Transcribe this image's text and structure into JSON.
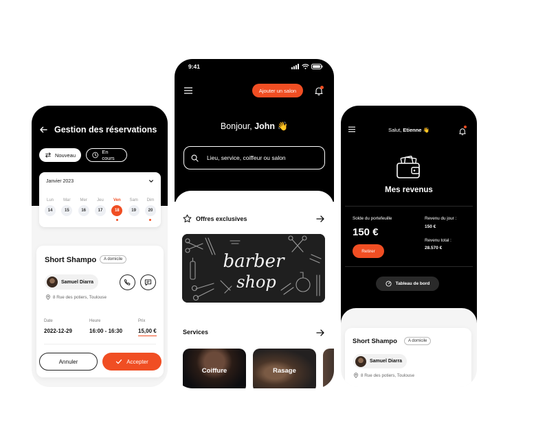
{
  "colors": {
    "accent": "#f04e23",
    "dark": "#000000",
    "surface": "#ffffff"
  },
  "left": {
    "title": "Gestion des réservations",
    "chips": [
      {
        "label": "Nouveau",
        "icon": "arrows-icon"
      },
      {
        "label": "En cours",
        "icon": "clock-icon"
      }
    ],
    "calendar": {
      "month": "Janvier 2023",
      "days": [
        {
          "name": "Lun",
          "num": "14",
          "selected": false,
          "dot": false
        },
        {
          "name": "Mar",
          "num": "15",
          "selected": false,
          "dot": false
        },
        {
          "name": "Mer",
          "num": "16",
          "selected": false,
          "dot": false
        },
        {
          "name": "Jeu",
          "num": "17",
          "selected": false,
          "dot": false
        },
        {
          "name": "Ven",
          "num": "18",
          "selected": true,
          "dot": true
        },
        {
          "name": "Sam",
          "num": "19",
          "selected": false,
          "dot": false
        },
        {
          "name": "Dim",
          "num": "20",
          "selected": false,
          "dot": true
        }
      ]
    },
    "booking": {
      "service": "Short Shampo",
      "badge": "A domicile",
      "client": "Samuel Diarra",
      "address": "8 Rue des potiers, Toulouse",
      "date_label": "Date",
      "date_value": "2022-12-29",
      "time_label": "Heure",
      "time_value": "16:00 - 16:30",
      "price_label": "Prix",
      "price_value": "15,00 €",
      "cancel": "Annuler",
      "accept": "Accepter"
    }
  },
  "center": {
    "status_time": "9:41",
    "cta": "Ajouter un salon",
    "greeting_prefix": "Bonjour, ",
    "greeting_name": "John",
    "greeting_emoji": "👋",
    "search_placeholder": "Lieu, service, coiffeur ou salon",
    "offers_title": "Offres exclusives",
    "banner_text_1": "barber",
    "banner_text_2": "shop",
    "services_title": "Services",
    "services": [
      "Coiffure",
      "Rasage"
    ]
  },
  "right": {
    "greeting_prefix": "Salut, ",
    "greeting_name": "Etienne",
    "greeting_emoji": "👋",
    "title": "Mes revenus",
    "wallet_label": "Solde du portefeuille",
    "wallet_value": "150 €",
    "day_label": "Revenu du jour :",
    "day_value": "150 €",
    "total_label": "Revenu total :",
    "total_value": "28.570 €",
    "withdraw": "Retirer",
    "dashboard": "Tableau de bord",
    "booking": {
      "service": "Short Shampo",
      "badge": "A domicile",
      "client": "Samuel Diarra",
      "address": "8 Rue des potiers, Toulouse"
    }
  }
}
